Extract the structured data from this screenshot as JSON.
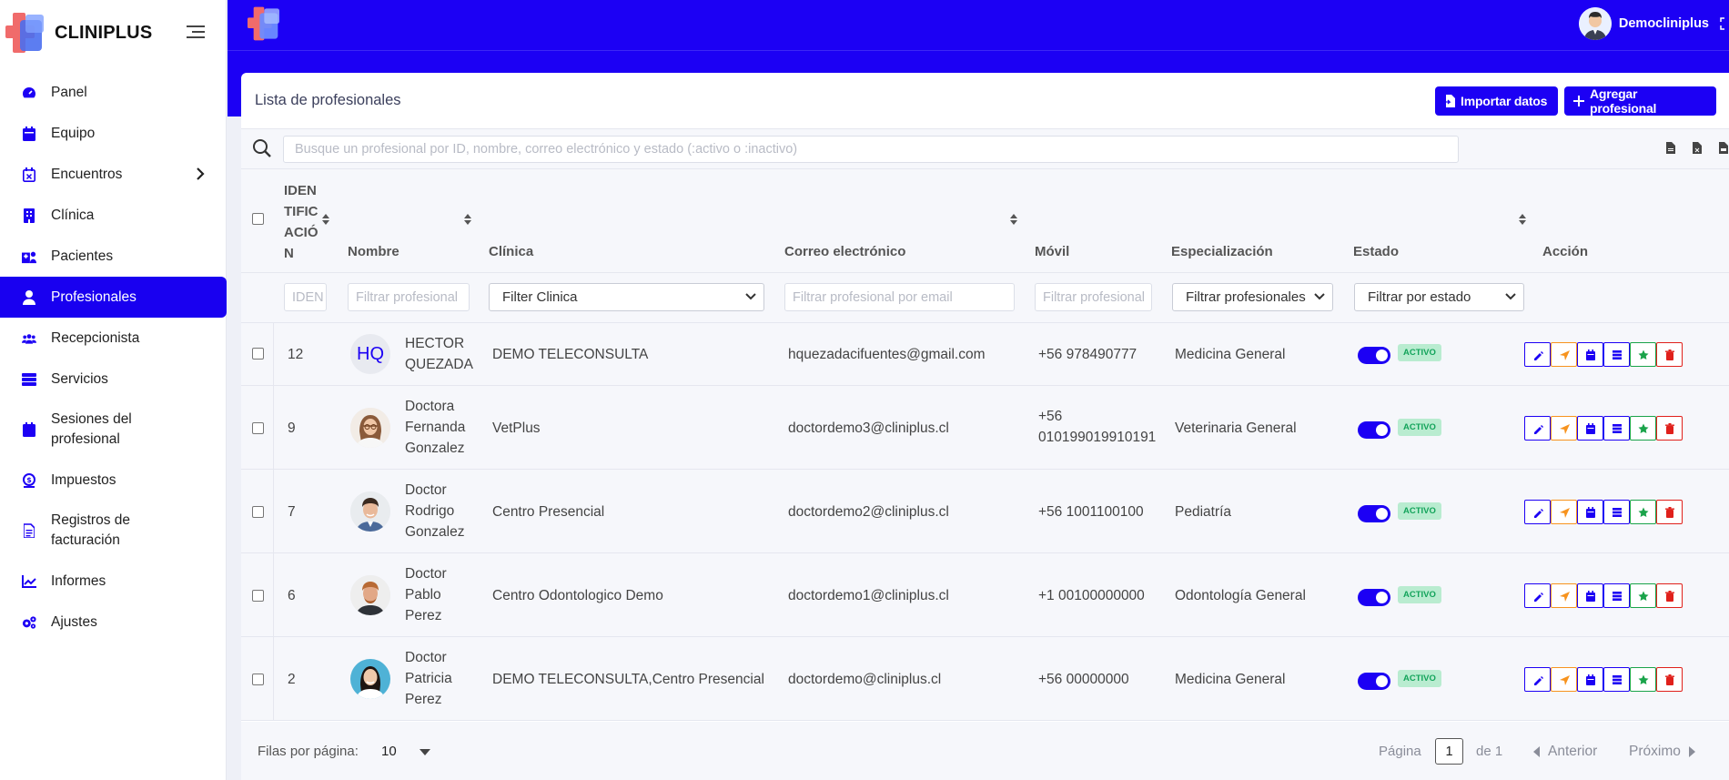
{
  "brand": {
    "name": "CLINIPLUS"
  },
  "sidebar": {
    "items": [
      {
        "label": "Panel",
        "icon": "dashboard-icon"
      },
      {
        "label": "Equipo",
        "icon": "calendar-icon"
      },
      {
        "label": "Encuentros",
        "icon": "calendar-x-icon"
      },
      {
        "label": "Clínica",
        "icon": "building-icon"
      },
      {
        "label": "Pacientes",
        "icon": "hospital-user-icon"
      },
      {
        "label": "Profesionales",
        "icon": "user-icon",
        "active": true
      },
      {
        "label": "Recepcionista",
        "icon": "users-icon"
      },
      {
        "label": "Servicios",
        "icon": "server-icon"
      },
      {
        "label": "Sesiones del profesional",
        "icon": "calendar-icon"
      },
      {
        "label": "Impuestos",
        "icon": "tax-icon"
      },
      {
        "label": "Registros de facturación",
        "icon": "invoice-icon"
      },
      {
        "label": "Informes",
        "icon": "chart-line-icon"
      },
      {
        "label": "Ajustes",
        "icon": "gears-icon"
      }
    ]
  },
  "topbar": {
    "user_name": "Democliniplus"
  },
  "card": {
    "title": "Lista de profesionales",
    "import_label": "Importar datos",
    "add_label": "Agregar profesional"
  },
  "search": {
    "placeholder": "Busque un profesional por ID, nombre, correo electrónico y estado (:activo o :inactivo)"
  },
  "table": {
    "headers": {
      "id": [
        "IDEN",
        "TIFIC",
        "ACIÓ",
        "N"
      ],
      "name": "Nombre",
      "clinic": "Clínica",
      "email": "Correo electrónico",
      "mobile": "Móvil",
      "specialization": "Especialización",
      "status": "Estado",
      "action": "Acción"
    },
    "filters": {
      "id": "IDEN",
      "name": "Filtrar profesional",
      "clinic": "Filter Clinica",
      "email": "Filtrar profesional por email",
      "mobile": "Filtrar profesional",
      "specialization": "Filtrar profesionales",
      "status": "Filtrar por estado"
    },
    "rows": [
      {
        "id": "12",
        "initials": "HQ",
        "name": [
          "HECTOR",
          "QUEZADA"
        ],
        "clinic": "DEMO TELECONSULTA",
        "email": "hquezadacifuentes@gmail.com",
        "mobile": [
          "+56 978490777"
        ],
        "specialization": "Medicina General",
        "status": "ACTIVO"
      },
      {
        "id": "9",
        "name": [
          "Doctora",
          "Fernanda",
          "Gonzalez"
        ],
        "clinic": "VetPlus",
        "email": "doctordemo3@cliniplus.cl",
        "mobile": [
          "+56",
          "010199019910191"
        ],
        "specialization": "Veterinaria General",
        "status": "ACTIVO"
      },
      {
        "id": "7",
        "name": [
          "Doctor",
          "Rodrigo",
          "Gonzalez"
        ],
        "clinic": "Centro Presencial",
        "email": "doctordemo2@cliniplus.cl",
        "mobile": [
          "+56 1001100100"
        ],
        "specialization": "Pediatría",
        "status": "ACTIVO"
      },
      {
        "id": "6",
        "name": [
          "Doctor",
          "Pablo",
          "Perez"
        ],
        "clinic": "Centro Odontologico Demo",
        "email": "doctordemo1@cliniplus.cl",
        "mobile": [
          "+1 00100000000"
        ],
        "specialization": "Odontología General",
        "status": "ACTIVO"
      },
      {
        "id": "2",
        "name": [
          "Doctor",
          "Patricia",
          "Perez"
        ],
        "clinic": "DEMO TELECONSULTA,Centro Presencial",
        "email": "doctordemo@cliniplus.cl",
        "mobile": [
          "+56 00000000"
        ],
        "specialization": "Medicina General",
        "status": "ACTIVO"
      }
    ],
    "action_icons": [
      "pencil-icon",
      "send-icon",
      "calendar-icon",
      "list-icon",
      "star-icon",
      "trash-icon"
    ]
  },
  "footer": {
    "rows_per_page_label": "Filas por página:",
    "rows_per_page_value": "10",
    "page_label": "Página",
    "page_value": "1",
    "of_label": "de 1",
    "prev_label": "Anterior",
    "next_label": "Próximo"
  },
  "colors": {
    "primary": "#1c00f4",
    "success": "#12a35a",
    "warning": "#f7931e",
    "danger": "#e0201b",
    "green": "#1aa34a"
  }
}
